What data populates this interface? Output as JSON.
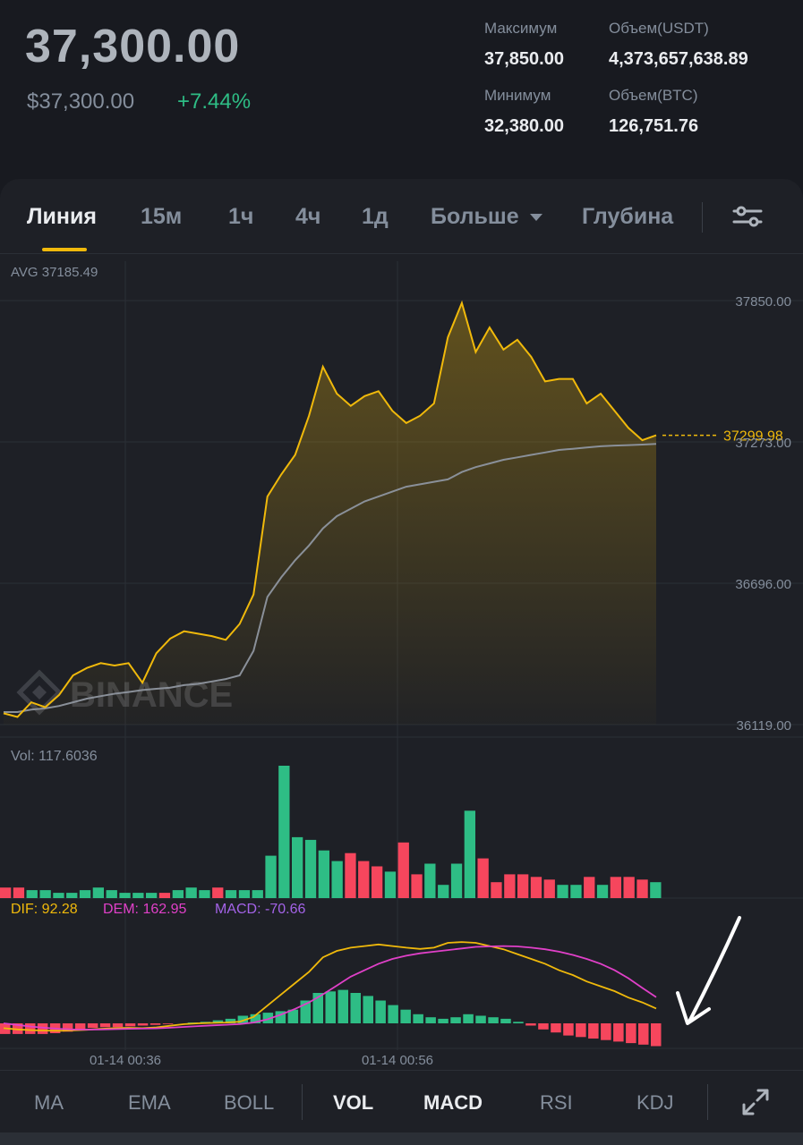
{
  "header": {
    "last_price": "37,300.00",
    "usd_price": "$37,300.00",
    "change": "+7.44%",
    "high_label": "Максимум",
    "high_value": "37,850.00",
    "low_label": "Минимум",
    "low_value": "32,380.00",
    "vol_usdt_label": "Объем(USDT)",
    "vol_usdt_value": "4,373,657,638.89",
    "vol_btc_label": "Объем(BTC)",
    "vol_btc_value": "126,751.76"
  },
  "tabs": [
    "Линия",
    "15м",
    "1ч",
    "4ч",
    "1д",
    "Больше",
    "Глубина"
  ],
  "active_tab": "Линия",
  "icons": {
    "settings": "sliders-icon",
    "more": "caret-down-icon",
    "expand": "expand-arrows-icon",
    "watermark": "binance-logo-icon"
  },
  "colors": {
    "price_line": "#f0b90b",
    "avg_line": "#8a9099",
    "up": "#2ebd85",
    "down": "#f6465d",
    "dem": "#e040c8",
    "macd": "#a463e8"
  },
  "chart": {
    "avg_label": "AVG 37185.49",
    "price_ticks": [
      "37850.00",
      "37273.00",
      "36696.00",
      "36119.00"
    ],
    "current_price_label": "37299.98",
    "watermark": "BINANCE",
    "vol_label": "Vol: 117.6036",
    "dif_label": "DIF: 92.28",
    "dem_label": "DEM: 162.95",
    "macd_label": "MACD: -70.66",
    "time_labels": [
      "01-14 00:36",
      "01-14 00:56"
    ]
  },
  "chart_data": {
    "type": "line",
    "ylim": [
      36119.0,
      37850.0
    ],
    "price": [
      36165,
      36150,
      36210,
      36190,
      36240,
      36320,
      36350,
      36370,
      36360,
      36370,
      36290,
      36410,
      36470,
      36500,
      36490,
      36480,
      36465,
      36530,
      36650,
      37050,
      37140,
      37220,
      37380,
      37580,
      37470,
      37420,
      37460,
      37480,
      37400,
      37350,
      37380,
      37430,
      37700,
      37840,
      37640,
      37740,
      37650,
      37690,
      37620,
      37520,
      37530,
      37530,
      37430,
      37470,
      37400,
      37330,
      37280,
      37300
    ],
    "avg": [
      36170,
      36170,
      36180,
      36185,
      36195,
      36210,
      36225,
      36235,
      36245,
      36252,
      36260,
      36265,
      36270,
      36280,
      36285,
      36295,
      36305,
      36320,
      36420,
      36640,
      36720,
      36790,
      36850,
      36920,
      36970,
      37000,
      37030,
      37050,
      37070,
      37090,
      37100,
      37110,
      37120,
      37150,
      37170,
      37185,
      37200,
      37210,
      37220,
      37230,
      37240,
      37245,
      37250,
      37255,
      37258,
      37260,
      37262,
      37265
    ],
    "volume": [
      4,
      4,
      3,
      3,
      2,
      2,
      3,
      4,
      3,
      2,
      2,
      2,
      2,
      3,
      4,
      3,
      4,
      3,
      3,
      3,
      16,
      50,
      23,
      22,
      18,
      14,
      17,
      14,
      12,
      10,
      21,
      9,
      13,
      5,
      13,
      33,
      15,
      6,
      9,
      9,
      8,
      7,
      5,
      5,
      8,
      5,
      8,
      8,
      7,
      6
    ],
    "volume_up": [
      false,
      false,
      true,
      true,
      true,
      true,
      true,
      true,
      true,
      true,
      true,
      true,
      false,
      true,
      true,
      true,
      false,
      true,
      true,
      true,
      true,
      true,
      true,
      true,
      true,
      true,
      false,
      false,
      false,
      true,
      false,
      false,
      true,
      true,
      true,
      true,
      false,
      false,
      false,
      false,
      false,
      false,
      true,
      true,
      false,
      true,
      false,
      false,
      false,
      true
    ],
    "dif": [
      -30,
      -38,
      -42,
      -45,
      -46,
      -44,
      -40,
      -34,
      -30,
      -28,
      -30,
      -25,
      -15,
      -5,
      0,
      3,
      5,
      10,
      40,
      110,
      180,
      250,
      320,
      410,
      450,
      470,
      480,
      490,
      480,
      470,
      462,
      470,
      500,
      505,
      500,
      480,
      460,
      430,
      400,
      370,
      330,
      300,
      260,
      230,
      200,
      160,
      130,
      92
    ],
    "dem": [
      0,
      -10,
      -20,
      -28,
      -34,
      -38,
      -39,
      -38,
      -36,
      -34,
      -33,
      -31,
      -27,
      -22,
      -17,
      -13,
      -9,
      -5,
      5,
      25,
      55,
      90,
      130,
      180,
      235,
      290,
      330,
      370,
      400,
      420,
      435,
      445,
      455,
      465,
      475,
      478,
      480,
      478,
      470,
      460,
      445,
      425,
      400,
      370,
      330,
      280,
      220,
      162.95
    ],
    "macd": [
      -14,
      -14,
      -14,
      -14,
      -13,
      -11,
      -8,
      -6,
      -5,
      -5,
      -4,
      -3,
      -2,
      -1,
      0,
      1,
      2,
      4,
      6,
      10,
      12,
      14,
      16,
      18,
      30,
      40,
      42,
      44,
      40,
      36,
      30,
      24,
      18,
      12,
      8,
      6,
      8,
      12,
      10,
      8,
      6,
      2,
      -3,
      -8,
      -12,
      -16,
      -18,
      -20,
      -22,
      -24,
      -26,
      -28,
      -30
    ],
    "time_labels": [
      "01-14 00:36",
      "01-14 00:56"
    ]
  },
  "indicators": [
    "MA",
    "EMA",
    "BOLL",
    "VOL",
    "MACD",
    "RSI",
    "KDJ"
  ],
  "active_indicators": [
    "VOL",
    "MACD"
  ]
}
